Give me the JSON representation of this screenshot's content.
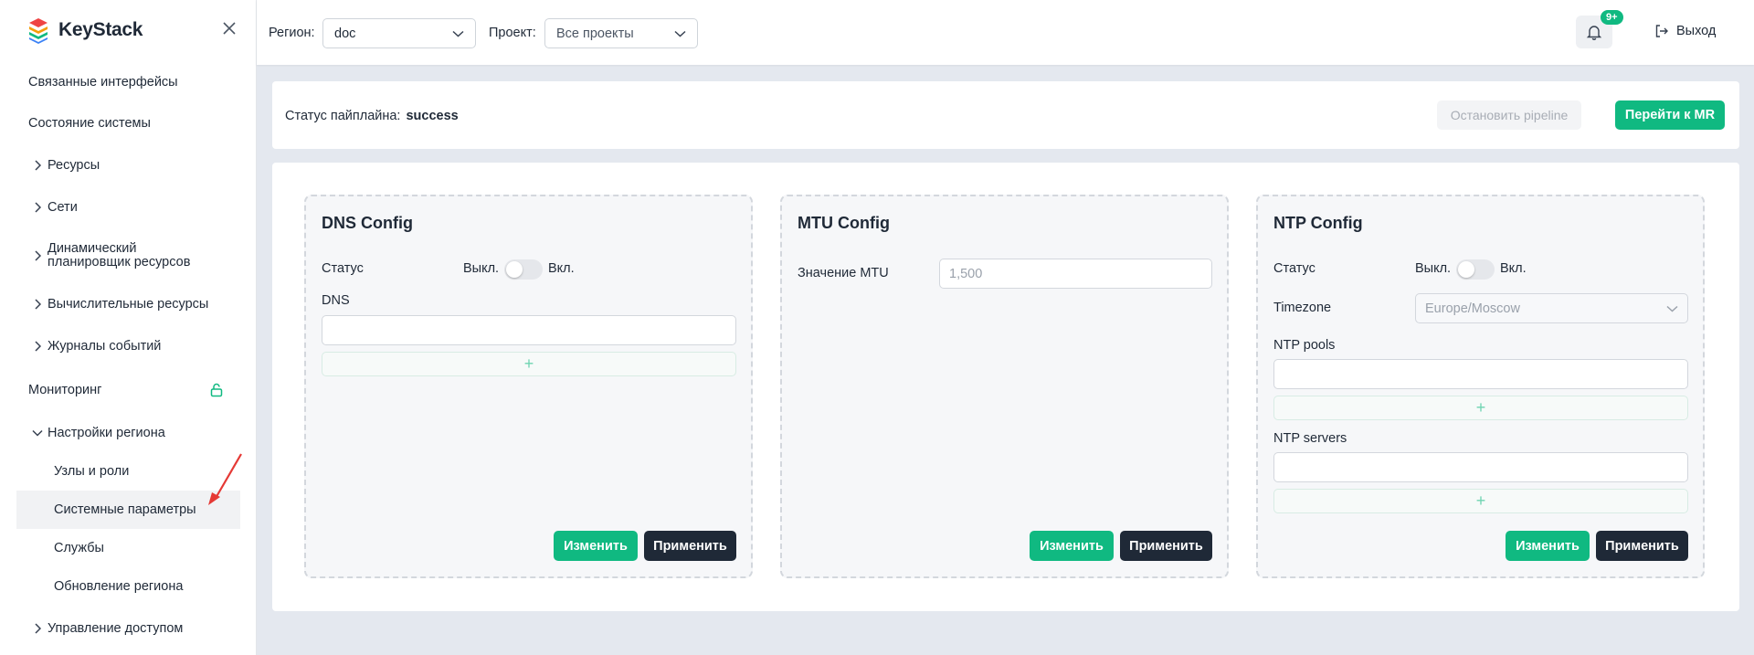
{
  "app": {
    "name": "KeyStack"
  },
  "sidebar": {
    "items": [
      {
        "label": "Связанные интерфейсы"
      },
      {
        "label": "Состояние системы"
      },
      {
        "label": "Ресурсы"
      },
      {
        "label": "Сети"
      },
      {
        "label": "Динамический планировщик ресурсов"
      },
      {
        "label": "Вычислительные ресурсы"
      },
      {
        "label": "Журналы событий"
      },
      {
        "label": "Мониторинг"
      },
      {
        "label": "Настройки региона"
      },
      {
        "label": "Узлы и роли"
      },
      {
        "label": "Системные параметры"
      },
      {
        "label": "Службы"
      },
      {
        "label": "Обновление региона"
      },
      {
        "label": "Управление доступом"
      }
    ]
  },
  "topbar": {
    "region_label": "Регион:",
    "region_value": "doc",
    "project_label": "Проект:",
    "project_value": "Все проекты",
    "notifications_badge": "9+",
    "logout_label": "Выход"
  },
  "pipeline": {
    "status_label": "Статус пайплайна:",
    "status_value": "success",
    "stop_label": "Остановить pipeline",
    "goto_mr_label": "Перейти к MR"
  },
  "cards": {
    "dns": {
      "title": "DNS Config",
      "status_label": "Статус",
      "off_label": "Выкл.",
      "on_label": "Вкл.",
      "field_label": "DNS",
      "field_value": "",
      "add_symbol": "+",
      "edit_label": "Изменить",
      "apply_label": "Применить"
    },
    "mtu": {
      "title": "MTU Config",
      "mtu_label": "Значение MTU",
      "mtu_value": "1,500",
      "edit_label": "Изменить",
      "apply_label": "Применить"
    },
    "ntp": {
      "title": "NTP Config",
      "status_label": "Статус",
      "off_label": "Выкл.",
      "on_label": "Вкл.",
      "timezone_label": "Timezone",
      "timezone_value": "Europe/Moscow",
      "pools_label": "NTP pools",
      "servers_label": "NTP servers",
      "add_symbol": "+",
      "edit_label": "Изменить",
      "apply_label": "Применить"
    }
  },
  "colors": {
    "accent_green": "#10b981",
    "dark_button": "#1f2937",
    "arrow_red": "#e53935"
  }
}
